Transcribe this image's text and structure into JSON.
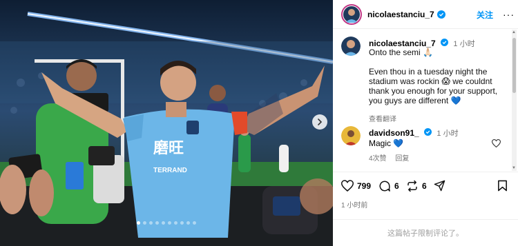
{
  "post": {
    "author": "nicolaestanciu_7",
    "follow_label": "关注",
    "more_label": "···",
    "caption_time": "1 小时",
    "caption_lines": [
      "Onto the semi 🙏🏻",
      "Even thou in a tuesday night the stadium was rockin 😱 we couldnt thank you enough for your support, you guys are different 💙"
    ],
    "translate_label": "查看翻译",
    "comment": {
      "author": "davidson91_",
      "time": "1 小时",
      "text": "Magic 💙",
      "likes_label": "4次赞",
      "reply_label": "回复"
    },
    "likes_count": "799",
    "comments_count": "6",
    "shares_count": "6",
    "posted_ago": "1 小时前",
    "comments_limited": "这篇帖子限制评论了。"
  },
  "carousel": {
    "total": 10,
    "active_index": 0
  },
  "jersey": {
    "sponsor": "磨旺",
    "sub": "TERRAND"
  },
  "colors": {
    "verified": "#0095f6",
    "follow": "#0095f6",
    "jersey": "#6cb6e8"
  }
}
